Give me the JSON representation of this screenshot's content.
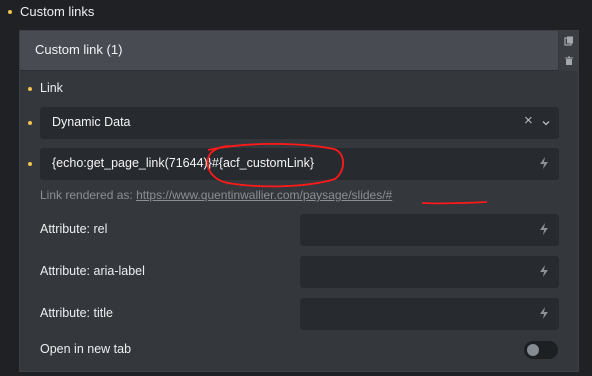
{
  "section": {
    "label": "Custom links"
  },
  "panel": {
    "title": "Custom link (1)",
    "actions": [
      {
        "name": "duplicate-icon"
      },
      {
        "name": "trash-icon"
      }
    ]
  },
  "link_group": {
    "label": "Link",
    "type_select": {
      "value": "Dynamic Data",
      "clear_glyph": "×",
      "arrow_glyph": "⌄"
    },
    "url_field": {
      "value": "{echo:get_page_link(71644)}#{acf_customLink}",
      "icon": "bolt-icon"
    },
    "rendered": {
      "prefix": "Link rendered as:",
      "url": "https://www.quentinwallier.com/paysage/slides/#"
    }
  },
  "attributes": [
    {
      "label": "Attribute: rel",
      "value": ""
    },
    {
      "label": "Attribute: aria-label",
      "value": ""
    },
    {
      "label": "Attribute: title",
      "value": ""
    }
  ],
  "new_tab": {
    "label": "Open in new tab",
    "enabled": false
  },
  "colors": {
    "background": "#1f2124",
    "panel": "#34373c",
    "panel_header": "#484c52",
    "field": "#272a2e",
    "accent_dot": "#f2c14e",
    "annotation": "#ff1a1a"
  }
}
